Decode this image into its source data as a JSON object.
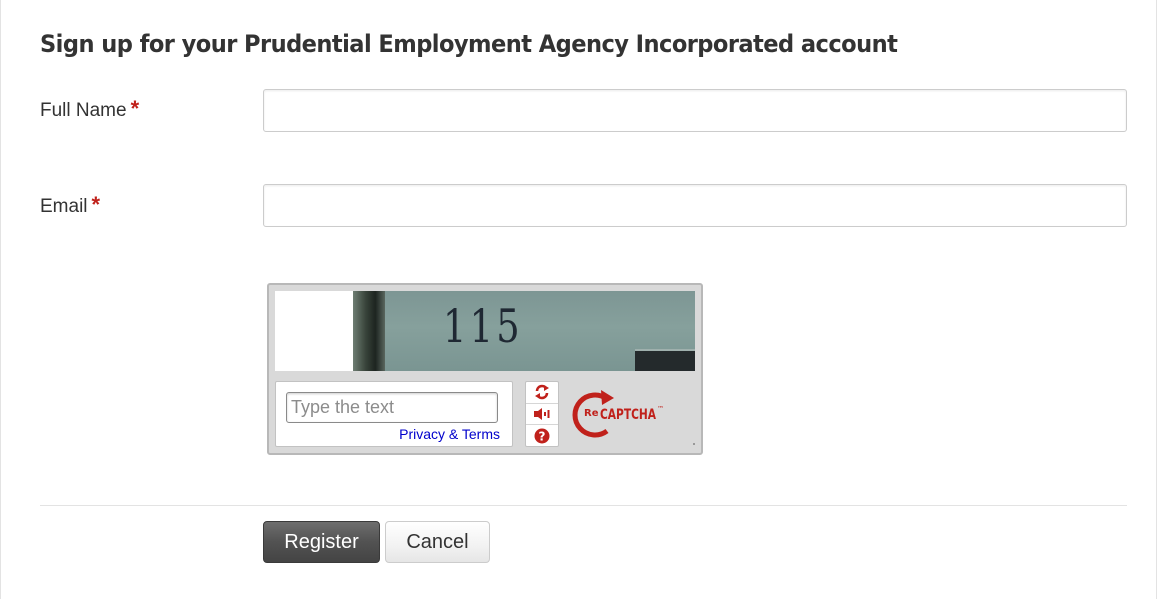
{
  "page": {
    "title": "Sign up for your Prudential Employment Agency Incorporated account"
  },
  "form": {
    "full_name": {
      "label": "Full Name",
      "required_marker": "*",
      "value": ""
    },
    "email": {
      "label": "Email",
      "required_marker": "*",
      "value": ""
    }
  },
  "captcha": {
    "challenge_text": "115",
    "input_placeholder": "Type the text",
    "privacy_link": "Privacy & Terms",
    "controls": [
      "refresh-icon",
      "audio-icon",
      "help-icon"
    ],
    "logo_re": "Re",
    "logo_text": "CAPTCHA",
    "logo_tm": "™"
  },
  "actions": {
    "register_label": "Register",
    "cancel_label": "Cancel"
  },
  "colors": {
    "required": "#c0211b",
    "recaptcha_red": "#c0211b",
    "link": "#0000cc",
    "primary_button": "#525252"
  }
}
